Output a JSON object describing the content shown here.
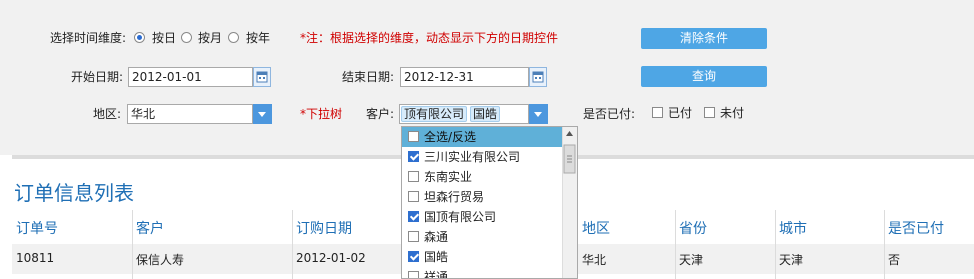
{
  "filters": {
    "time_dimension_label": "选择时间维度:",
    "radio_options": [
      "按日",
      "按月",
      "按年"
    ],
    "note": "*注：根据选择的维度，动态显示下方的日期控件",
    "clear_button": "清除条件",
    "start_label": "开始日期:",
    "start_value": "2012-01-01",
    "end_label": "结束日期:",
    "end_value": "2012-12-31",
    "query_button": "查询",
    "region_label": "地区:",
    "region_value": "华北",
    "dropdown_tree_note": "*下拉树",
    "customer_label": "客户:",
    "customer_tags": [
      "顶有限公司",
      "国皓"
    ],
    "paid_label": "是否已付:",
    "paid_options": [
      "已付",
      "未付"
    ]
  },
  "customer_dropdown": {
    "items": [
      {
        "label": "全选/反选",
        "checked": false
      },
      {
        "label": "三川实业有限公司",
        "checked": true
      },
      {
        "label": "东南实业",
        "checked": false
      },
      {
        "label": "坦森行贸易",
        "checked": false
      },
      {
        "label": "国顶有限公司",
        "checked": true
      },
      {
        "label": "森通",
        "checked": false
      },
      {
        "label": "国皓",
        "checked": true
      },
      {
        "label": "祥通",
        "checked": false
      }
    ]
  },
  "orders": {
    "title": "订单信息列表",
    "columns": [
      "订单号",
      "客户",
      "订购日期",
      "地区",
      "省份",
      "城市",
      "是否已付"
    ],
    "rows": [
      {
        "order_id": "10811",
        "customer": "保信人寿",
        "date": "2012-01-02",
        "region": "华北",
        "province": "天津",
        "city": "天津",
        "paid": "否"
      }
    ]
  },
  "colors": {
    "accent": "#4ea6e5",
    "title_blue": "#1f6fb5",
    "note_red": "#d00000"
  }
}
